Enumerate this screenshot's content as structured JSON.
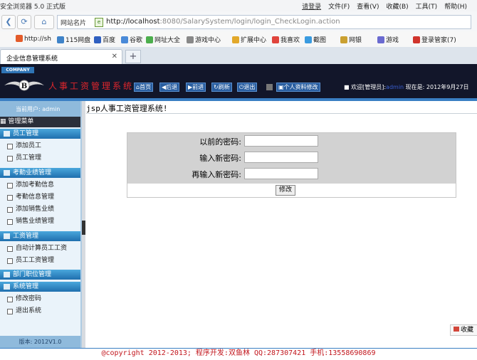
{
  "browser": {
    "title": "安全浏览器 5.0 正式版",
    "login": "请登录",
    "menus": [
      "文件(F)",
      "查看(V)",
      "收藏(B)",
      "工具(T)",
      "帮助(H)"
    ],
    "site_label": "网站名片",
    "url_host": "http://localhost",
    "url_rest": ":8080/SalarySystem/login/login_CheckLogin.action",
    "favorites": [
      "http://sh",
      "115网盘",
      "百度",
      "谷歌",
      "网址大全",
      "游戏中心",
      "扩展中心",
      "我喜欢",
      "截图",
      "网银",
      "游戏",
      "登录管家(7)"
    ],
    "tab_title": "企业信息管理系统"
  },
  "header": {
    "company_badge": "COMPANY",
    "system_title": "人事工资管理系统",
    "nav": [
      "首页",
      "后退",
      "前进",
      "刷新",
      "退出"
    ],
    "profile_button": "个人资料修改",
    "welcome_prefix": "欢迎[管理员]:",
    "welcome_user": "admin",
    "date_text": "现在是: 2012年9月27日"
  },
  "sidebar": {
    "current_user": "当前用户: admin",
    "menu_title": "管理菜单",
    "sections": [
      {
        "label": "员工管理",
        "items": [
          "添加员工",
          "员工管理"
        ]
      },
      {
        "label": "考勤业绩管理",
        "items": [
          "添加考勤信息",
          "考勤信息管理",
          "添加销售业绩",
          "销售业绩管理"
        ]
      },
      {
        "label": "工资管理",
        "items": [
          "自动计算员工工资",
          "员工工资管理"
        ]
      },
      {
        "label": "部门职位管理",
        "items": []
      },
      {
        "label": "系统管理",
        "items": [
          "修改密码",
          "退出系统"
        ]
      }
    ],
    "version": "版本: 2012V1.0"
  },
  "content": {
    "crumb": "jsp人事工资管理系统!",
    "old_password_label": "以前的密码:",
    "new_password_label": "输入新密码:",
    "confirm_password_label": "再输入新密码:",
    "submit_label": "修改",
    "collect_label": "收藏"
  },
  "footer": {
    "text": "@copyright 2012-2013;  程序开发:双鱼林  QQ:287307421  手机:13558690869"
  },
  "colors": {
    "header_bg": "#12162a",
    "accent_blue": "#2f74b5",
    "title_red": "#e0262c",
    "footer_red": "#c2161d"
  }
}
